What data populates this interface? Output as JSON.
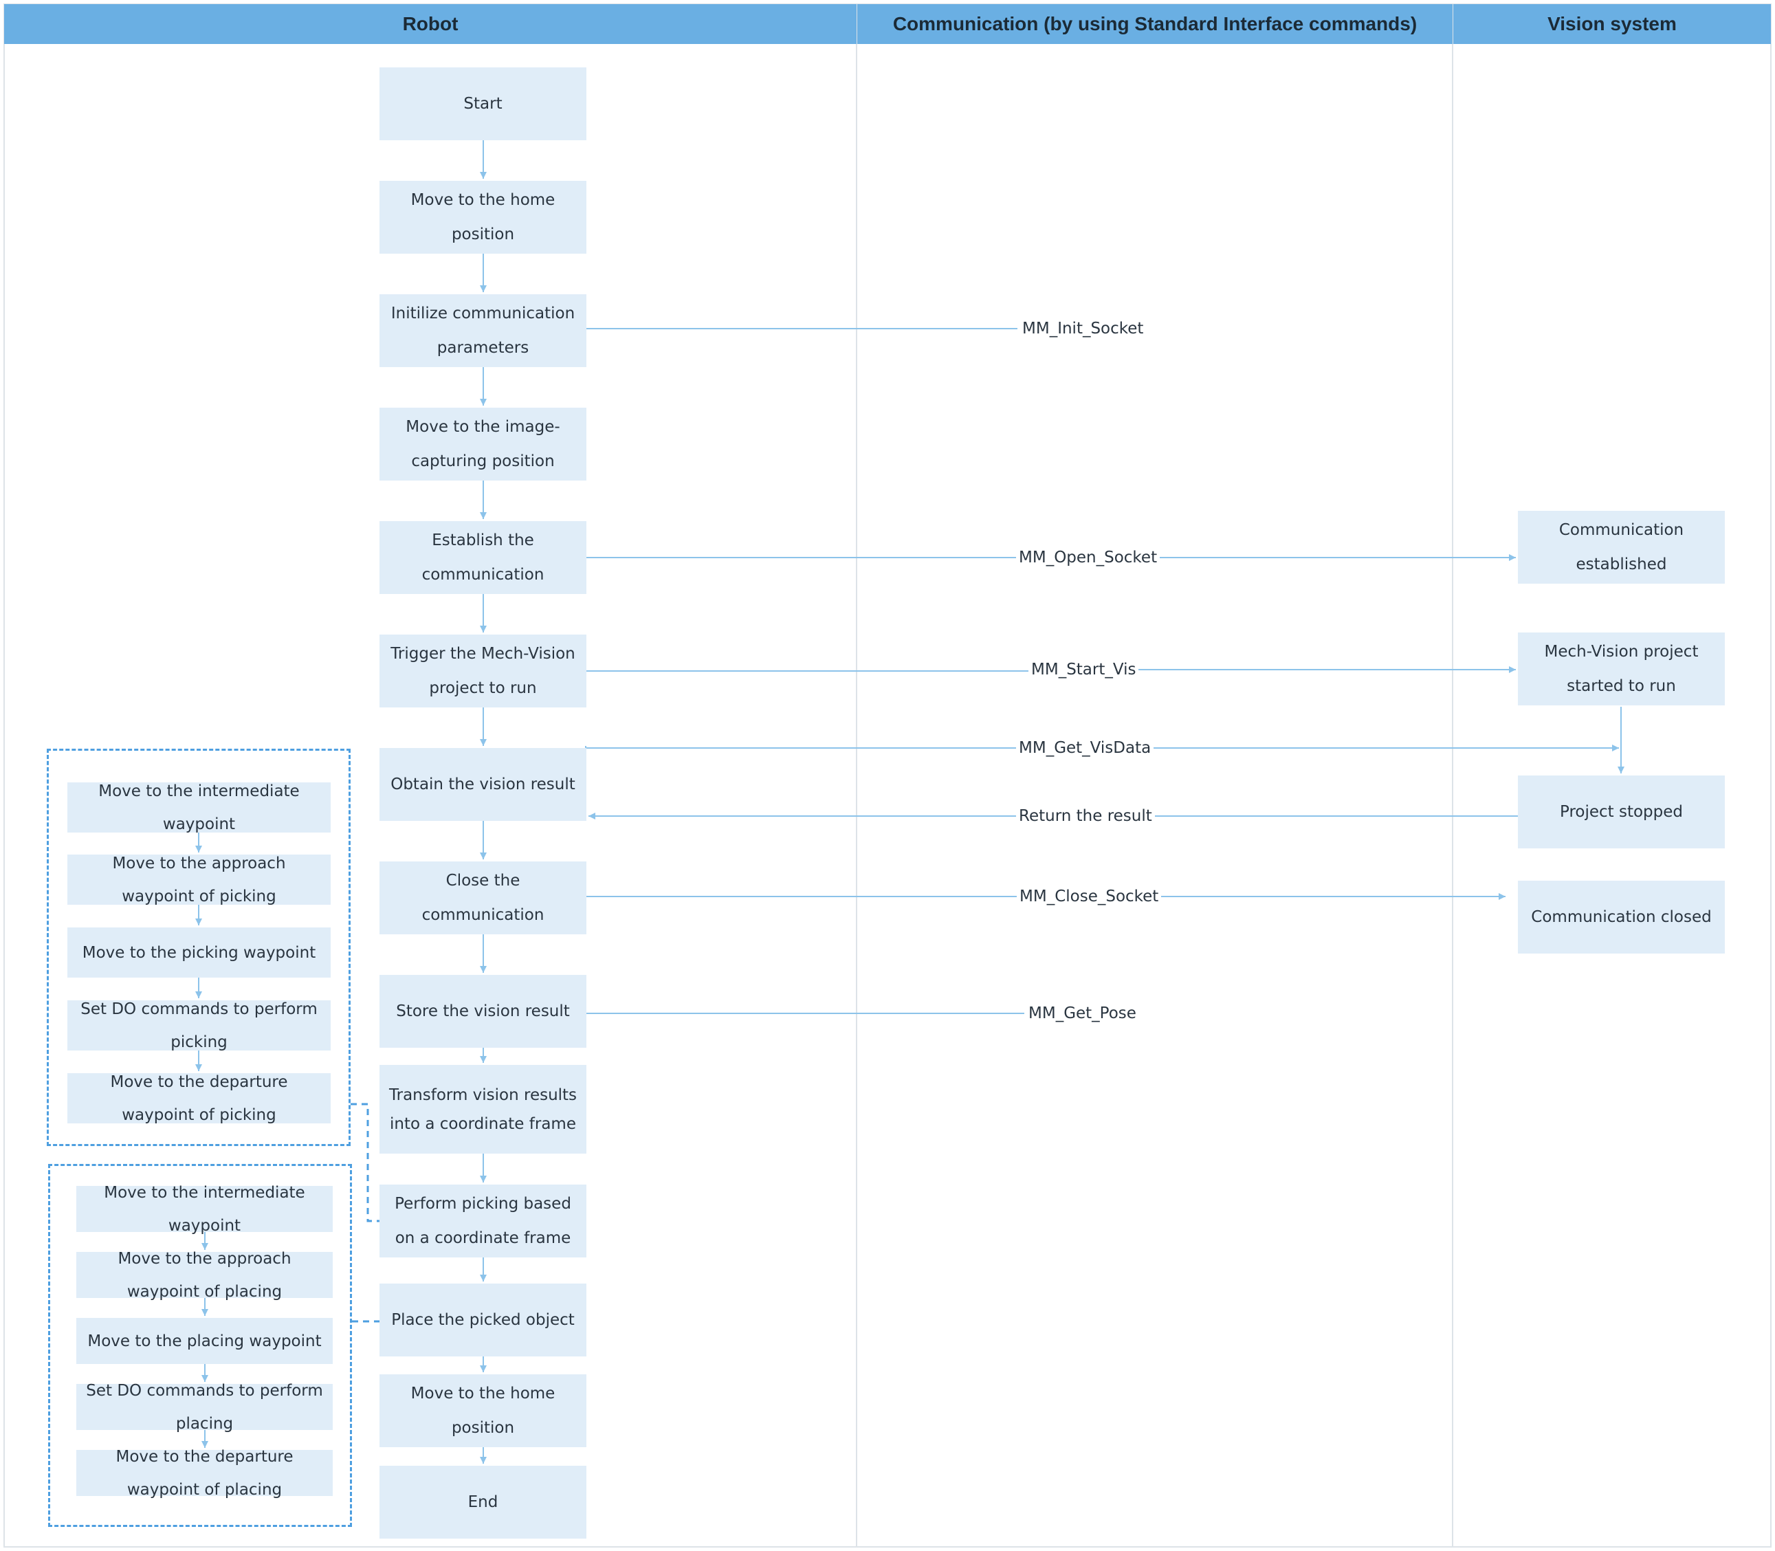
{
  "headers": {
    "robot": "Robot",
    "communication": "Communication (by using Standard Interface commands)",
    "vision": "Vision system"
  },
  "robot_steps": [
    "Start",
    "Move to the home position",
    "Initilize communication parameters",
    "Move to the image-capturing position",
    "Establish the communication",
    "Trigger the Mech-Vision project to run",
    "Obtain the vision result",
    "Close the communication",
    "Store the vision result",
    "Transform vision results into a coordinate frame",
    "Perform picking based on a coordinate frame",
    "Place the picked object",
    "Move to the home position",
    "End"
  ],
  "picking_substeps": [
    "Move to the intermediate waypoint",
    "Move to the approach waypoint of picking",
    "Move to the picking waypoint",
    "Set DO commands to perform picking",
    "Move to the departure waypoint of picking"
  ],
  "placing_substeps": [
    "Move to the intermediate waypoint",
    "Move to the approach waypoint of placing",
    "Move to the placing waypoint",
    "Set DO commands to perform placing",
    "Move to the departure waypoint of placing"
  ],
  "vision_states": [
    "Communication established",
    "Mech-Vision project started to run",
    "Project stopped",
    "Communication closed"
  ],
  "commands": {
    "init_socket": "MM_Init_Socket",
    "open_socket": "MM_Open_Socket",
    "start_vis": "MM_Start_Vis",
    "get_visdata": "MM_Get_VisData",
    "return_result": "Return the result",
    "close_socket": "MM_Close_Socket",
    "get_pose": "MM_Get_Pose"
  },
  "colors": {
    "header": "#6aafe3",
    "node": "#e0edf8",
    "line": "#8cc3ea",
    "dashed": "#4e9fe0",
    "divider": "#dde3e8"
  }
}
